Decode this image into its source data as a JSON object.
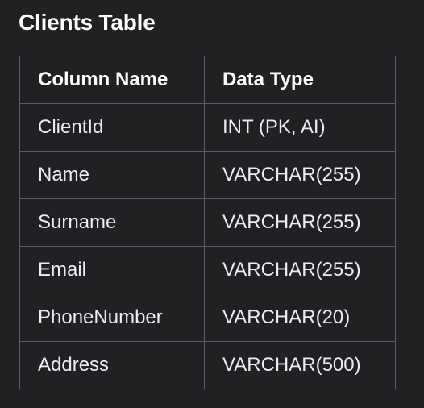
{
  "title": "Clients Table",
  "table": {
    "headers": [
      "Column Name",
      "Data Type"
    ],
    "rows": [
      [
        "ClientId",
        "INT (PK, AI)"
      ],
      [
        "Name",
        "VARCHAR(255)"
      ],
      [
        "Surname",
        "VARCHAR(255)"
      ],
      [
        "Email",
        "VARCHAR(255)"
      ],
      [
        "PhoneNumber",
        "VARCHAR(20)"
      ],
      [
        "Address",
        "VARCHAR(500)"
      ]
    ]
  },
  "colors": {
    "background": "#202123",
    "text": "#ececf1",
    "border": "#5c5c66"
  }
}
